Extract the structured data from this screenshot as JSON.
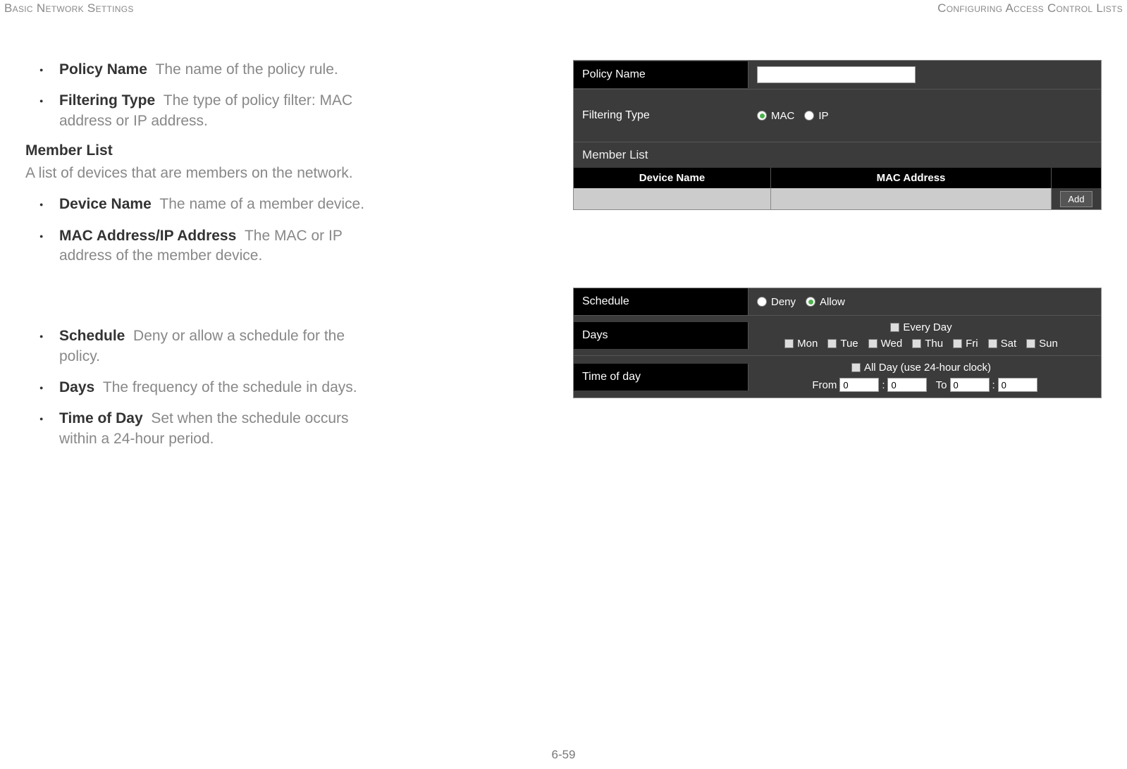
{
  "header": {
    "left": "Basic Network Settings",
    "right": "Configuring Access Control Lists"
  },
  "doc": {
    "bullets1": [
      {
        "term": "Policy Name",
        "desc": "The name of the policy rule."
      },
      {
        "term": "Filtering Type",
        "desc": "The type of policy filter: MAC address or IP address."
      }
    ],
    "member_head": "Member List",
    "member_desc": "A list of devices that are members on the network.",
    "bullets2": [
      {
        "term": "Device Name",
        "desc": "The name of a member device."
      },
      {
        "term": "MAC Address/IP Address",
        "desc": "The MAC or IP address of the member device."
      }
    ],
    "bullets3": [
      {
        "term": "Schedule",
        "desc": "Deny or allow a schedule for the policy."
      },
      {
        "term": "Days",
        "desc": "The frequency of the schedule in days."
      },
      {
        "term": "Time of Day",
        "desc": "Set when the schedule occurs within a 24-hour period."
      }
    ]
  },
  "panel1": {
    "policy_label": "Policy Name",
    "filter_label": "Filtering Type",
    "filter_mac": "MAC",
    "filter_ip": "IP",
    "member_title": "Member List",
    "col_device": "Device Name",
    "col_mac": "MAC Address",
    "add_btn": "Add"
  },
  "panel2": {
    "schedule_label": "Schedule",
    "deny": "Deny",
    "allow": "Allow",
    "days_label": "Days",
    "every_day": "Every Day",
    "mon": "Mon",
    "tue": "Tue",
    "wed": "Wed",
    "thu": "Thu",
    "fri": "Fri",
    "sat": "Sat",
    "sun": "Sun",
    "tod_label": "Time of day",
    "all_day": "All Day (use 24-hour clock)",
    "from": "From",
    "to": "To",
    "zero": "0",
    "colon": ":"
  },
  "footer": {
    "page": "6-59"
  }
}
